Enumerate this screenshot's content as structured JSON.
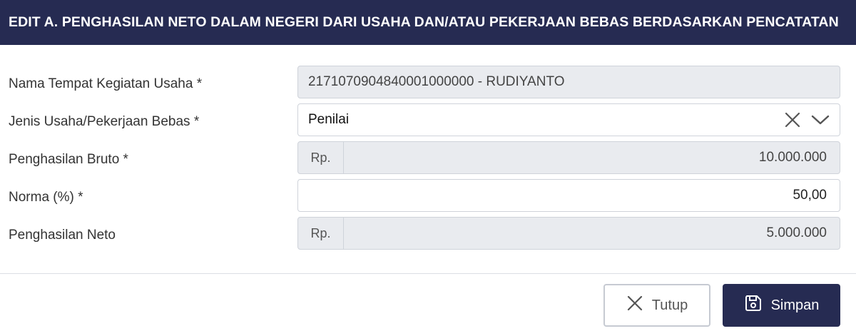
{
  "modal": {
    "title": "EDIT A. PENGHASILAN NETO DALAM NEGERI DARI USAHA DAN/ATAU PEKERJAAN BEBAS BERDASARKAN PENCATATAN"
  },
  "form": {
    "nama_tempat": {
      "label": "Nama Tempat Kegiatan Usaha *",
      "value": "2171070904840001000000 - RUDIYANTO"
    },
    "jenis_usaha": {
      "label": "Jenis Usaha/Pekerjaan Bebas *",
      "value": "Penilai"
    },
    "penghasilan_bruto": {
      "label": "Penghasilan Bruto *",
      "prefix": "Rp.",
      "value": "10.000.000"
    },
    "norma": {
      "label": "Norma (%) *",
      "value": "50,00"
    },
    "penghasilan_neto": {
      "label": "Penghasilan Neto",
      "prefix": "Rp.",
      "value": "5.000.000"
    }
  },
  "footer": {
    "close_label": "Tutup",
    "save_label": "Simpan"
  },
  "icons": {
    "clear": "close-icon",
    "dropdown": "chevron-down-icon",
    "close_button": "close-icon",
    "save_button": "save-icon"
  },
  "colors": {
    "header_bg": "#262b52",
    "readonly_bg": "#e9ebef",
    "border": "#cfd3da",
    "primary_button": "#262b52"
  }
}
